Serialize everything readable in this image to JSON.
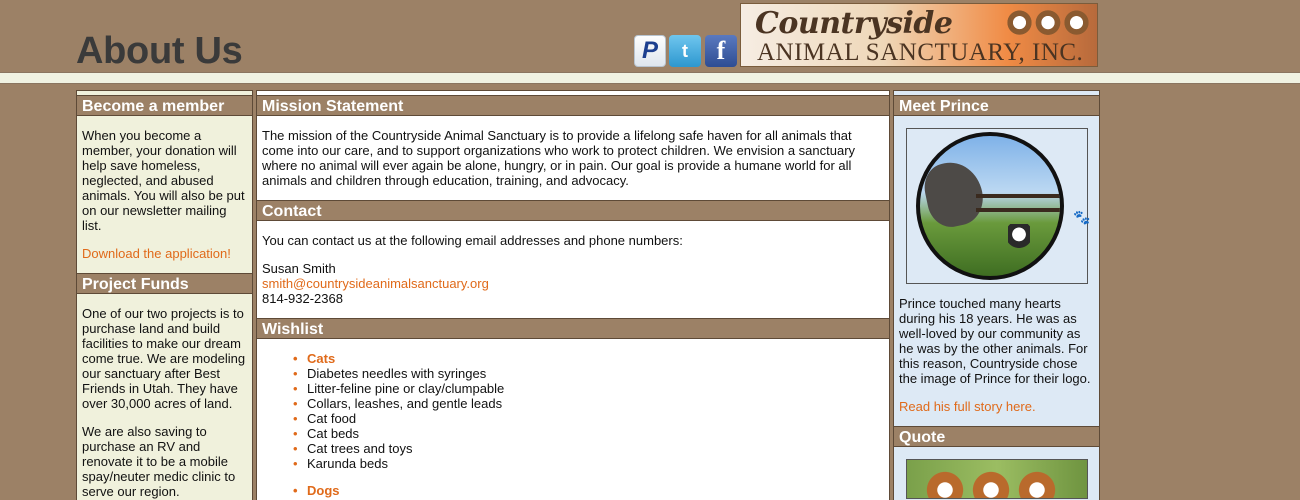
{
  "header": {
    "title": "About Us",
    "logo": {
      "line1": "Countryside",
      "line2": "ANIMAL SANCTUARY, INC."
    },
    "social": [
      {
        "name": "paypal",
        "glyph": "P"
      },
      {
        "name": "twitter",
        "glyph": "t"
      },
      {
        "name": "facebook",
        "glyph": "f"
      }
    ]
  },
  "left": {
    "member": {
      "heading": "Become a member",
      "text": "When you become a member, your donation will help save homeless, neglected, and abused animals. You will also be put on our newsletter mailing list.",
      "link": "Download the application!"
    },
    "funds": {
      "heading": "Project Funds",
      "p1": "One of our two projects is to purchase land and build facilities to make our dream come true. We are modeling our sanctuary after Best Friends in Utah. They have over 30,000 acres of land.",
      "p2": "We are also saving to purchase an RV and renovate it to be a mobile spay/neuter medic clinic to serve our region."
    }
  },
  "center": {
    "mission": {
      "heading": "Mission Statement",
      "text": "The mission of the Countryside Animal Sanctuary is to provide a lifelong safe haven for all animals that come into our care, and to support organizations who work to protect children. We envision a sanctuary where no animal will ever again be alone, hungry, or in pain. Our goal is provide a humane world for all animals and children through education, training, and advocacy."
    },
    "contact": {
      "heading": "Contact",
      "intro": "You can contact us at the following email addresses and phone numbers:",
      "name": "Susan Smith",
      "email": "smith@countrysideanimalsanctuary.org",
      "phone": "814-932-2368"
    },
    "wishlist": {
      "heading": "Wishlist",
      "cats_label": "Cats",
      "cats": [
        "Diabetes needles with syringes",
        "Litter-feline pine or clay/clumpable",
        "Collars, leashes, and gentle leads",
        "Cat food",
        "Cat beds",
        "Cat trees and toys",
        "Karunda beds"
      ],
      "dogs_label": "Dogs"
    }
  },
  "right": {
    "prince": {
      "heading": "Meet Prince",
      "text": "Prince touched many hearts during his 18 years. He was as well-loved by our community as he was by the other animals. For this reason, Countryside chose the image of Prince for their logo.",
      "link": "Read his full story here."
    },
    "quote": {
      "heading": "Quote"
    }
  },
  "colors": {
    "background": "#9c8166",
    "accent": "#e06a1a",
    "left_panel": "#f0f1dc",
    "right_panel": "#dde9f5"
  }
}
